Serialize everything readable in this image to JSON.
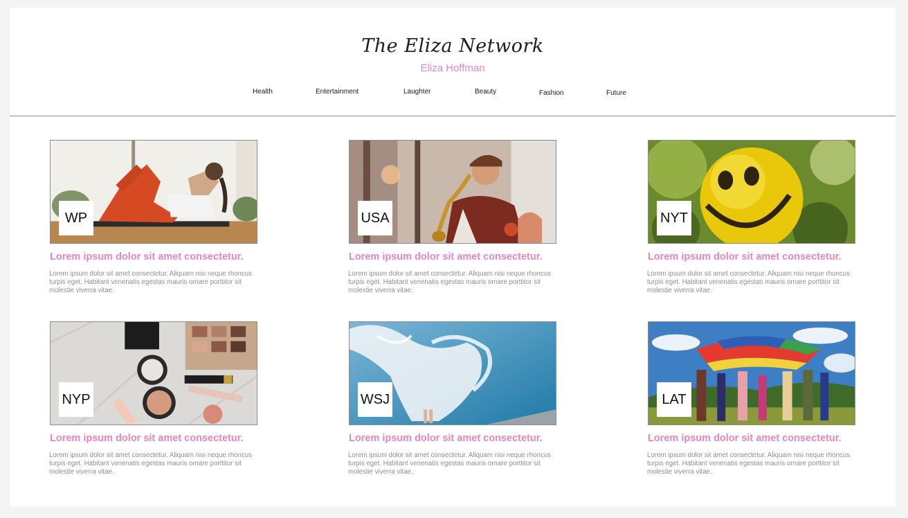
{
  "header": {
    "brand": "The Eliza Network",
    "author": "Eliza Hoffman"
  },
  "nav": [
    {
      "label": "Health"
    },
    {
      "label": "Entertainment"
    },
    {
      "label": "Laughter"
    },
    {
      "label": "Beauty"
    },
    {
      "label": "Fashion"
    },
    {
      "label": "Future"
    }
  ],
  "colors": {
    "accent": "#ea85bb",
    "body_text": "#8e8e8e",
    "divider": "#8a8a8a",
    "background": "#f4f4f4"
  },
  "articles": [
    {
      "source": "WP",
      "image": "woman-doing-crunches-photo",
      "title": "Lorem ipsum dolor sit amet consectetur.",
      "body": "Lorem ipsum dolor sit amet consectetur. Aliquam nisi neque rhoncus turpis eget. Habitant venenatis egestas mauris ornare porttitor sit molestie viverra vitae."
    },
    {
      "source": "USA",
      "image": "saxophone-player-photo",
      "title": "Lorem ipsum dolor sit amet consectetur.",
      "body": "Lorem ipsum dolor sit amet consectetur. Aliquam nisi neque rhoncus turpis eget. Habitant venenatis egestas mauris ornare porttitor sit molestie viverra vitae."
    },
    {
      "source": "NYT",
      "image": "smiley-ball-photo",
      "title": "Lorem ipsum dolor sit amet consectetur.",
      "body": "Lorem ipsum dolor sit amet consectetur. Aliquam nisi neque rhoncus turpis eget. Habitant venenatis egestas mauris ornare porttitor sit molestie viverra vitae."
    },
    {
      "source": "NYP",
      "image": "makeup-flatlay-photo",
      "title": "Lorem ipsum dolor sit amet consectetur.",
      "body": "Lorem ipsum dolor sit amet consectetur. Aliquam nisi neque rhoncus turpis eget. Habitant venenatis egestas mauris ornare porttitor sit molestie viverra vitae."
    },
    {
      "source": "WSJ",
      "image": "flowing-white-dress-photo",
      "title": "Lorem ipsum dolor sit amet consectetur.",
      "body": "Lorem ipsum dolor sit amet consectetur. Aliquam nisi neque rhoncus turpis eget. Habitant venenatis egestas mauris ornare porttitor sit molestie viverra vitae."
    },
    {
      "source": "LAT",
      "image": "kids-parachute-game-photo",
      "title": "Lorem ipsum dolor sit amet consectetur.",
      "body": "Lorem ipsum dolor sit amet consectetur. Aliquam nisi neque rhoncus turpis eget. Habitant venenatis egestas mauris ornare porttitor sit molestie viverra vitae."
    }
  ]
}
